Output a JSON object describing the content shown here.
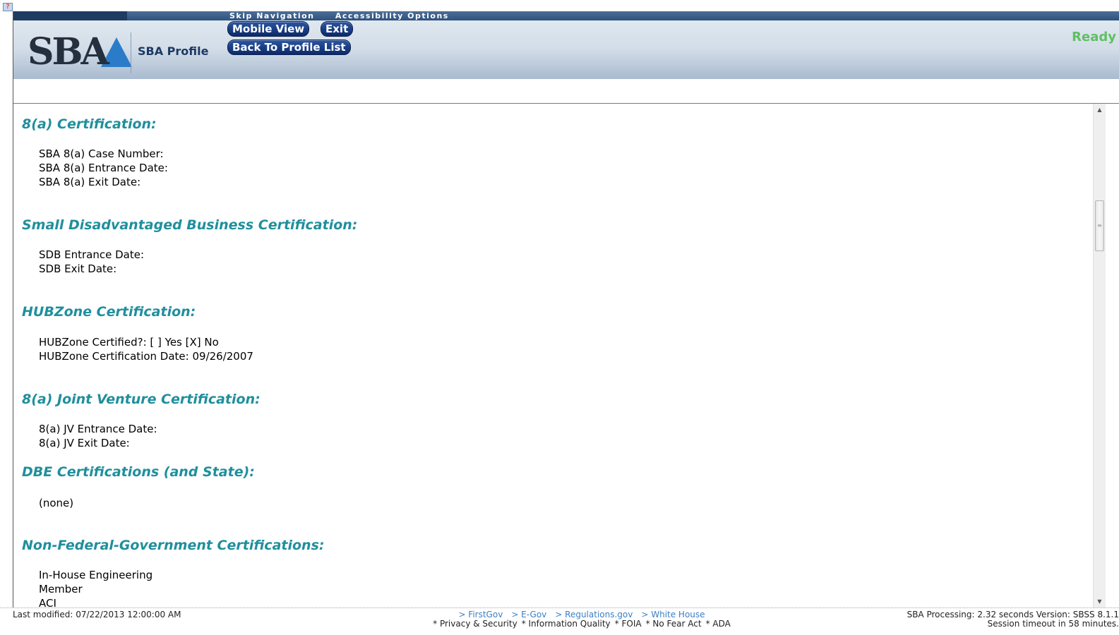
{
  "header": {
    "skip_navigation": "Skip Navigation",
    "accessibility_options": "Accessibility Options",
    "logo_text": "SBA",
    "profile_title": "SBA Profile",
    "mobile_view_label": "Mobile View",
    "exit_label": "Exit",
    "back_label": "Back To Profile List",
    "status": "Ready"
  },
  "sections": [
    {
      "title": "8(a) Certification:",
      "lines": [
        "SBA 8(a) Case Number:",
        "SBA 8(a) Entrance Date:",
        "SBA 8(a) Exit Date:"
      ]
    },
    {
      "title": "Small Disadvantaged Business Certification:",
      "lines": [
        "SDB Entrance Date:",
        "SDB Exit Date:"
      ]
    },
    {
      "title": "HUBZone Certification:",
      "lines": [
        "HUBZone Certified?: [  ] Yes [X] No",
        "HUBZone Certification Date: 09/26/2007"
      ]
    },
    {
      "title": "8(a) Joint Venture Certification:",
      "lines": [
        "8(a) JV Entrance Date:",
        "8(a) JV Exit Date:"
      ]
    },
    {
      "title": "DBE Certifications (and State):",
      "lines": [
        "(none)"
      ]
    },
    {
      "title": "Non-Federal-Government Certifications:",
      "lines": [
        "In-House Engineering",
        "Member",
        "ACI"
      ]
    }
  ],
  "footer": {
    "last_modified": "Last modified: 07/22/2013 12:00:00 AM",
    "links": [
      "> FirstGov",
      "> E-Gov",
      "> Regulations.gov",
      "> White House"
    ],
    "links2": [
      "* Privacy & Security",
      "* Information Quality",
      "* FOIA",
      "* No Fear Act",
      "* ADA"
    ],
    "processing": "SBA Processing:  2.32 seconds Version: SBSS 8.1.1",
    "session": "Session timeout in 58 minutes."
  },
  "icons": {
    "broken_image": "broken-image-icon",
    "scroll_up": "scroll-up-arrow-icon",
    "scroll_down": "scroll-down-arrow-icon"
  }
}
